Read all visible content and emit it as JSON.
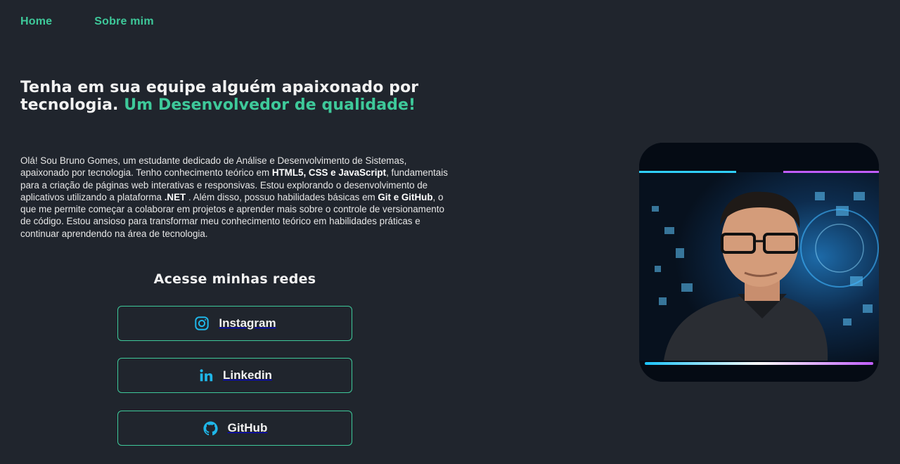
{
  "nav": {
    "items": [
      {
        "label": "Home"
      },
      {
        "label": "Sobre mim"
      }
    ]
  },
  "hero": {
    "headline_part1": "Tenha em sua equipe alguém apaixonado por tecnologia.",
    "headline_part2": "Um Desenvolvedor de qualidade!",
    "bio": [
      {
        "t": "Olá! Sou Bruno Gomes, um estudante dedicado de Análise e Desenvolvimento de Sistemas, apaixonado por tecnologia. Tenho conhecimento teórico em ",
        "b": false
      },
      {
        "t": "HTML5, CSS e JavaScript",
        "b": true
      },
      {
        "t": ", fundamentais para a criação de páginas web interativas e responsivas. Estou explorando o desenvolvimento de aplicativos utilizando a plataforma ",
        "b": false
      },
      {
        "t": ".NET",
        "b": true
      },
      {
        "t": " . Além disso, possuo habilidades básicas em ",
        "b": false
      },
      {
        "t": "Git e GitHub",
        "b": true
      },
      {
        "t": ", o que me permite começar a colaborar em projetos e aprender mais sobre o controle de versionamento de código. Estou ansioso para transformar meu conhecimento teórico em habilidades práticas e continuar aprendendo na área de tecnologia.",
        "b": false
      }
    ]
  },
  "social": {
    "title": "Acesse minhas redes",
    "buttons": [
      {
        "label": "Instagram",
        "icon": "instagram-icon"
      },
      {
        "label": "Linkedin",
        "icon": "linkedin-icon"
      },
      {
        "label": "GitHub",
        "icon": "github-icon"
      }
    ]
  },
  "colors": {
    "background": "#20252d",
    "accent": "#3ec99a",
    "icon_blue": "#1fb6e8"
  }
}
